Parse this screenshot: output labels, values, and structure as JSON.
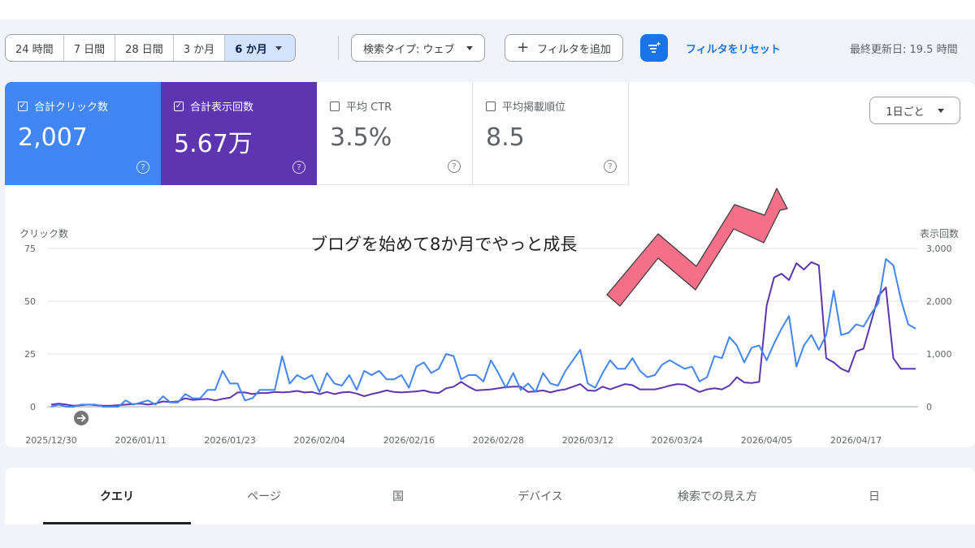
{
  "toolbar": {
    "date_ranges": [
      {
        "label": "24 時間",
        "active": false
      },
      {
        "label": "7 日間",
        "active": false
      },
      {
        "label": "28 日間",
        "active": false
      },
      {
        "label": "3 か月",
        "active": false
      },
      {
        "label": "6 か月",
        "active": true
      }
    ],
    "search_type": "検索タイプ: ウェブ",
    "add_filter": "フィルタを追加",
    "reset_filters": "フィルタをリセット",
    "last_updated": "最終更新日: 19.5 時間"
  },
  "metrics": [
    {
      "label": "合計クリック数",
      "value": "2,007",
      "checked": true,
      "color": "#4285f4"
    },
    {
      "label": "合計表示回数",
      "value": "5.67万",
      "checked": true,
      "color": "#5e35b1"
    },
    {
      "label": "平均 CTR",
      "value": "3.5%",
      "checked": false
    },
    {
      "label": "平均掲載順位",
      "value": "8.5",
      "checked": false
    }
  ],
  "interval_select": "1日ごと",
  "annotation": "ブログを始めて8か月でやっと成長",
  "chart_data": {
    "type": "line",
    "left_axis_label": "クリック数",
    "right_axis_label": "表示回数",
    "y_left_ticks": [
      "75",
      "50",
      "25",
      "0"
    ],
    "y_right_ticks": [
      "3,000",
      "2,000",
      "1,000",
      "0"
    ],
    "ylim_left": [
      0,
      75
    ],
    "ylim_right": [
      0,
      3000
    ],
    "x_tick_labels": [
      "2025/12/30",
      "2026/01/11",
      "2026/01/23",
      "2026/02/04",
      "2026/02/16",
      "2026/02/28",
      "2026/03/12",
      "2026/03/24",
      "2026/04/05",
      "2026/04/17"
    ],
    "series": [
      {
        "name": "クリック数",
        "axis": "left",
        "color": "#4285f4",
        "values": [
          0,
          1,
          0,
          0,
          1,
          1,
          1,
          0,
          0,
          0,
          3,
          1,
          2,
          3,
          1,
          5,
          2,
          2,
          6,
          4,
          4,
          8,
          8,
          17,
          11,
          11,
          3,
          4,
          8,
          8,
          8,
          24,
          11,
          15,
          13,
          15,
          7,
          16,
          11,
          10,
          15,
          8,
          17,
          15,
          17,
          13,
          13,
          15,
          9,
          19,
          21,
          16,
          18,
          25,
          24,
          13,
          15,
          15,
          12,
          22,
          16,
          9,
          16,
          8,
          11,
          7,
          16,
          11,
          10,
          17,
          22,
          27,
          11,
          9,
          16,
          22,
          18,
          18,
          23,
          17,
          14,
          15,
          20,
          22,
          20,
          18,
          19,
          12,
          14,
          24,
          23,
          33,
          29,
          21,
          28,
          29,
          22,
          30,
          37,
          43,
          19,
          29,
          34,
          27,
          34,
          55,
          34,
          35,
          39,
          38,
          44,
          49,
          70,
          67,
          51,
          39,
          37
        ]
      },
      {
        "name": "表示回数",
        "axis": "right",
        "color": "#5e35b1",
        "values": [
          40,
          60,
          40,
          20,
          30,
          40,
          30,
          20,
          20,
          30,
          40,
          50,
          60,
          40,
          60,
          100,
          90,
          100,
          160,
          130,
          140,
          150,
          120,
          150,
          170,
          270,
          270,
          240,
          260,
          260,
          280,
          270,
          280,
          300,
          270,
          280,
          240,
          280,
          240,
          270,
          280,
          250,
          200,
          240,
          270,
          310,
          280,
          270,
          280,
          290,
          310,
          270,
          260,
          350,
          380,
          470,
          380,
          310,
          320,
          330,
          350,
          370,
          380,
          380,
          280,
          290,
          310,
          270,
          310,
          330,
          380,
          430,
          310,
          300,
          380,
          330,
          380,
          430,
          410,
          330,
          330,
          330,
          360,
          400,
          430,
          420,
          350,
          280,
          330,
          350,
          330,
          400,
          560,
          460,
          450,
          470,
          1920,
          2450,
          2520,
          2400,
          2720,
          2600,
          2740,
          2680,
          920,
          840,
          720,
          660,
          1050,
          1100,
          1600,
          2100,
          2260,
          920,
          720,
          720,
          720
        ]
      }
    ]
  },
  "tabs": [
    "クエリ",
    "ページ",
    "国",
    "デバイス",
    "検索での見え方",
    "日"
  ]
}
